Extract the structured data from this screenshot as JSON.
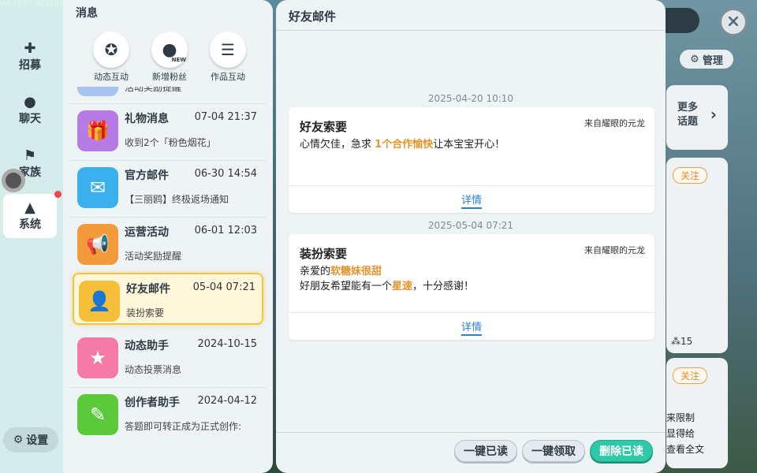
{
  "version_text": "Ver [1.47.0][58][6.2...",
  "sidebar": {
    "items": [
      {
        "label": "招募",
        "icon": "plus-box-icon"
      },
      {
        "label": "聊天",
        "icon": "chat-bubble-icon"
      },
      {
        "label": "家族",
        "icon": "flag-icon"
      },
      {
        "label": "系统",
        "icon": "bell-icon"
      }
    ],
    "settings_label": "设置"
  },
  "messages_panel": {
    "title": "消息",
    "quick_buttons": [
      {
        "label": "动态互动",
        "icon": "star-chat-icon"
      },
      {
        "label": "新增粉丝",
        "icon": "user-new-icon",
        "badge": "NEW"
      },
      {
        "label": "作品互动",
        "icon": "list-doc-icon"
      }
    ],
    "partial_item_text": "活动奖励提醒",
    "items": [
      {
        "name": "礼物消息",
        "time": "07-04 21:37",
        "preview": "收到2个「粉色烟花」",
        "color": "#b77be6",
        "icon": "gift-icon"
      },
      {
        "name": "官方邮件",
        "time": "06-30 14:54",
        "preview": "【三丽鸥】终极返场通知",
        "color": "#3bb0ee",
        "icon": "envelope-icon"
      },
      {
        "name": "运营活动",
        "time": "06-01 12:03",
        "preview": "活动奖励提醒",
        "color": "#f39a3a",
        "icon": "megaphone-icon"
      },
      {
        "name": "好友邮件",
        "time": "05-04 07:21",
        "preview": "装扮索要",
        "color": "#f5bf3a",
        "icon": "friend-mail-icon"
      },
      {
        "name": "动态助手",
        "time": "2024-10-15",
        "preview": "动态投票消息",
        "color": "#f57aa5",
        "icon": "bookmark-star-icon"
      },
      {
        "name": "创作者助手",
        "time": "2024-04-12",
        "preview": "答题即可转正成为正式创作:",
        "color": "#5cc93b",
        "icon": "pencil-ruler-icon"
      }
    ]
  },
  "mail_panel": {
    "title": "好友邮件",
    "mails": [
      {
        "date": "2025-04-20 10:10",
        "title": "好友索要",
        "from": "来自耀眼的元龙",
        "line1_pre": "心情欠佳，急求",
        "line1_hl": "1个合作愉快",
        "line1_post": "让本宝宝开心！",
        "detail_label": "详情"
      },
      {
        "date": "2025-05-04 07:21",
        "title": "装扮索要",
        "from": "来自耀眼的元龙",
        "line1_pre": "亲爱的",
        "line1_hl": "软糖妹很甜",
        "line2_pre": "好朋友希望能有一个",
        "line2_hl": "星速",
        "line2_post": "，十分感谢！",
        "detail_label": "详情"
      }
    ],
    "actions": {
      "read_all": "一键已读",
      "claim_all": "一键领取",
      "delete_read": "删除已读"
    }
  },
  "background": {
    "close_icon": "×",
    "manage_label": "管理",
    "topic_line1": "更多",
    "topic_line2": "话题",
    "follow_label": "关注",
    "likes_count": "15",
    "feed_lines": [
      "来限制",
      "显得给",
      "查看全文"
    ]
  },
  "colors": {
    "accent_green": "#2fc8a8",
    "highlight_orange": "#e6932a",
    "link_blue": "#2a7fd4",
    "selected_border": "#f5c542"
  }
}
